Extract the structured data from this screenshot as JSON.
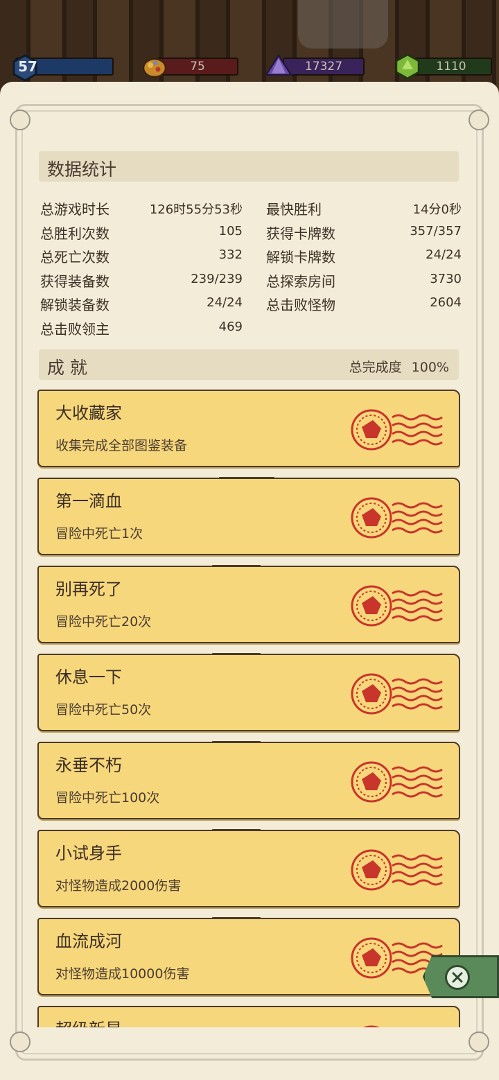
{
  "resources": {
    "level": "57",
    "gold": "75",
    "gems": "17327",
    "green": "1110"
  },
  "stats_section": {
    "title": "数据统计",
    "left": [
      {
        "label": "总游戏时长",
        "value": "126时55分53秒"
      },
      {
        "label": "总胜利次数",
        "value": "105"
      },
      {
        "label": "总死亡次数",
        "value": "332"
      },
      {
        "label": "获得装备数",
        "value": "239/239"
      },
      {
        "label": "解锁装备数",
        "value": "24/24"
      },
      {
        "label": "总击败领主",
        "value": "469"
      }
    ],
    "right": [
      {
        "label": "最快胜利",
        "value": "14分0秒"
      },
      {
        "label": "获得卡牌数",
        "value": "357/357"
      },
      {
        "label": "解锁卡牌数",
        "value": "24/24"
      },
      {
        "label": "总探索房间",
        "value": "3730"
      },
      {
        "label": "总击败怪物",
        "value": "2604"
      }
    ]
  },
  "achievements_section": {
    "title": "成 就",
    "completion_label": "总完成度",
    "completion_value": "100%",
    "items": [
      {
        "title": "大收藏家",
        "desc": "收集完成全部图鉴装备"
      },
      {
        "title": "第一滴血",
        "desc": "冒险中死亡1次"
      },
      {
        "title": "别再死了",
        "desc": "冒险中死亡20次"
      },
      {
        "title": "休息一下",
        "desc": "冒险中死亡50次"
      },
      {
        "title": "永垂不朽",
        "desc": "冒险中死亡100次"
      },
      {
        "title": "小试身手",
        "desc": "对怪物造成2000伤害"
      },
      {
        "title": "血流成河",
        "desc": "对怪物造成10000伤害"
      },
      {
        "title": "超级新星",
        "desc": ""
      }
    ]
  },
  "colors": {
    "parchment": "#f3ecd9",
    "card": "#f7d77c",
    "stamp_red": "#c8352a",
    "close_green": "#5b8a5a"
  },
  "icons": {
    "level": "hexagon-level-icon",
    "gold": "gold-nugget-icon",
    "gems": "purple-gem-icon",
    "green": "green-gem-icon",
    "stamp": "postmark-stamp-icon",
    "close": "close-x-icon"
  }
}
